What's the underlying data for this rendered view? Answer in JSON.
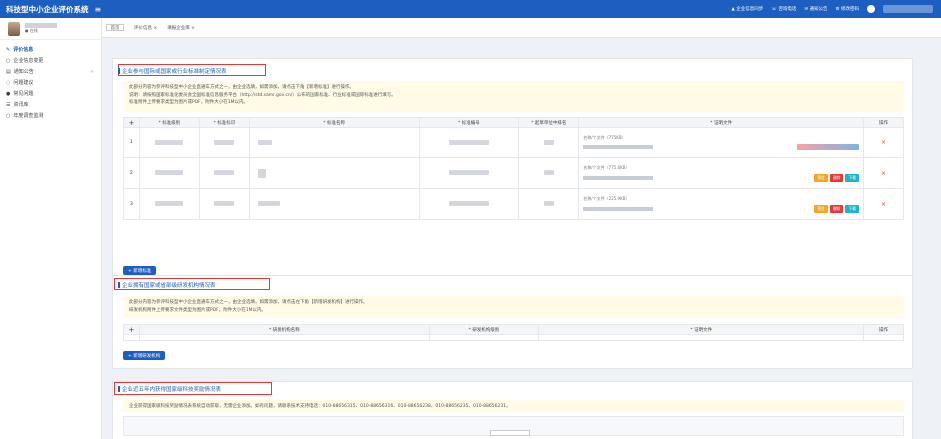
{
  "header": {
    "app_title": "科技型中小企业评价系统",
    "menu_icon": "≡",
    "links": [
      "企业信息同步",
      "咨询电话",
      "通知公告",
      "修改密码"
    ]
  },
  "sidebar": {
    "online": "● 在线",
    "items": [
      {
        "label": "评价信息",
        "icon": "✎",
        "active": true
      },
      {
        "label": "企业信息变更",
        "icon": "○",
        "active": false
      },
      {
        "label": "通知公告",
        "icon": "▤",
        "arrow": "‹"
      },
      {
        "label": "问题建议",
        "icon": "◌"
      },
      {
        "label": "常见问题",
        "icon": "●"
      },
      {
        "label": "资讯库",
        "icon": "☰"
      },
      {
        "label": "年度调查监测",
        "icon": "○"
      }
    ]
  },
  "breadcrumb": {
    "home": "首页",
    "items": [
      "评价信息 ×",
      "填报企业库 ×"
    ]
  },
  "section1": {
    "title": "企业参与国际或国家或行业标准制定情况表",
    "notice": [
      "此部分内容为参评科技型中小企业直通车方式之一，由企业选填，如需添加，请点击下角【新增标准】进行操作。",
      "说明：请按照国家标准化委员会全国标准信息服务平台（http://std.samr.gov.cn/）公布的国家标准、行业标准或国际标准进行填写。",
      "标准附件上传要求类型为图片或PDF，附件大小在1M以内。"
    ],
    "columns": [
      "+",
      "* 标准级别",
      "* 标准标识",
      "* 标准名称",
      "* 标准编号",
      "* 起草单位中排名",
      "* 证明文件",
      "操作"
    ],
    "rows": [
      {
        "no": "1",
        "file_label": "名称/个文件（775KB）"
      },
      {
        "no": "2",
        "file_label": "名称/个文件（775.6KB）"
      },
      {
        "no": "3",
        "file_label": "名称/个文件（225.9KB）"
      }
    ],
    "btn_preview": "预览",
    "btn_delete": "删除",
    "btn_download": "下载",
    "delete_icon": "×",
    "add_button": "+ 新增标准"
  },
  "section2": {
    "title": "企业拥有国家或省部级研发机构情况表",
    "notice": [
      "此部分内容为参评科技型中小企业直通车方式之一，由企业选填，如需添加，请点击左下角【新增研发机构】进行操作。",
      "研发机构附件上传要求文件类型为图片或PDF，附件大小在1M以内。"
    ],
    "columns": [
      "+",
      "* 研发机构名称",
      "* 研发机构级别",
      "* 证明文件",
      "操作"
    ],
    "add_button": "+ 新增研发机构"
  },
  "section3": {
    "title": "企业近五年内获得国家级科技奖励情况表",
    "notice": "企业获得国家级科技奖励情况表系统自动获取，无需企业添加。如有问题，请联系技术支持电话：010-88656315、010-88656316、010-88656238、010-88656235、010-88656231。"
  },
  "colors": {
    "brand": "#1d5fc1",
    "highlight": "#e53935",
    "notice_bg": "#fffbe6"
  }
}
